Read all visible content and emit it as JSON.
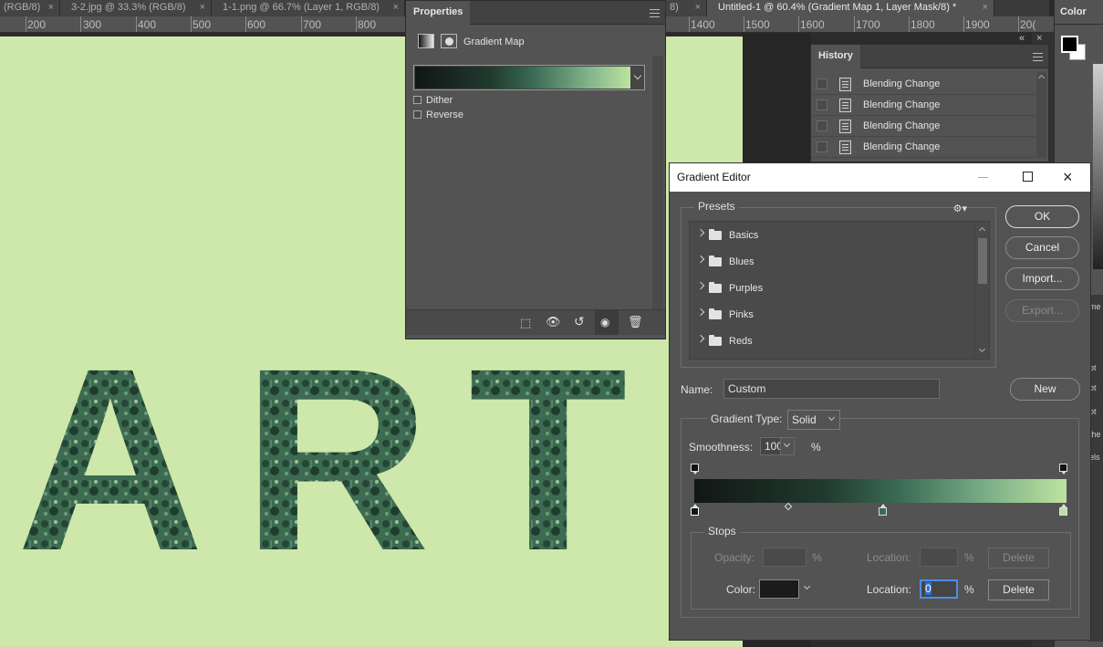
{
  "tabs": [
    {
      "label": "(RGB/8)"
    },
    {
      "label": "3-2.jpg @ 33.3% (RGB/8)"
    },
    {
      "label": "1-1.png @ 66.7% (Layer 1, RGB/8)"
    },
    {
      "label": "8)"
    },
    {
      "label": "Untitled-1 @ 60.4% (Gradient Map 1, Layer Mask/8) *"
    }
  ],
  "ruler": {
    "left_labels": [
      "200",
      "300",
      "400",
      "500",
      "600",
      "700",
      "800"
    ],
    "right_labels": [
      "1400",
      "1500",
      "1600",
      "1700",
      "1800",
      "1900",
      "20("
    ]
  },
  "canvas": {
    "text": "ART",
    "bg_color": "#cde8aa",
    "letter_color": "#2f5640"
  },
  "properties": {
    "tab": "Properties",
    "type_label": "Gradient Map",
    "dither": "Dither",
    "reverse": "Reverse"
  },
  "history": {
    "tab": "History",
    "items": [
      "Blending Change",
      "Blending Change",
      "Blending Change",
      "Blending Change"
    ]
  },
  "colorpanel": {
    "tab": "Color",
    "side_labels": [
      "me",
      "ot",
      "ot",
      "ot",
      "the",
      "els"
    ]
  },
  "gradient_editor": {
    "title": "Gradient Editor",
    "presets_label": "Presets",
    "folders": [
      "Basics",
      "Blues",
      "Purples",
      "Pinks",
      "Reds"
    ],
    "buttons": {
      "ok": "OK",
      "cancel": "Cancel",
      "import": "Import...",
      "export": "Export...",
      "new": "New",
      "delete": "Delete"
    },
    "name_label": "Name:",
    "name_value": "Custom",
    "gradient_type_label": "Gradient Type:",
    "gradient_type_value": "Solid",
    "smoothness_label": "Smoothness:",
    "smoothness_value": "100",
    "percent": "%",
    "stops_label": "Stops",
    "opacity_label": "Opacity:",
    "location_label": "Location:",
    "color_label": "Color:",
    "color_location_value": "0",
    "gradient_colors": [
      "#111614",
      "#213a2e",
      "#3a6b55",
      "#7fb28a",
      "#bde39f"
    ],
    "color_stop_value": "#1a1c1b"
  }
}
